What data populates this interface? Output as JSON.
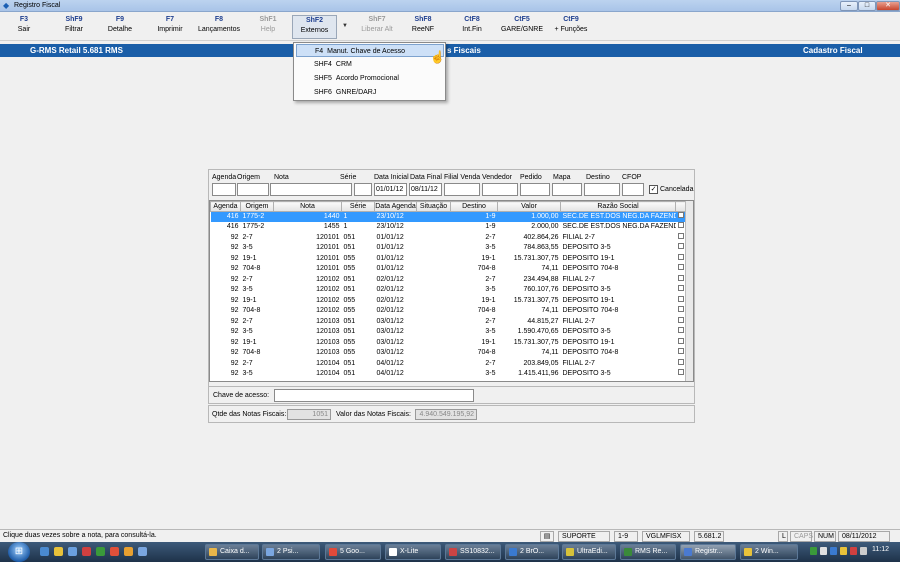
{
  "window": {
    "title": "Registro Fiscal"
  },
  "toolbar": [
    {
      "key": "F3",
      "label": "Sair",
      "enabled": true
    },
    {
      "key": "ShF9",
      "label": "Filtrar",
      "enabled": true
    },
    {
      "key": "F9",
      "label": "Detalhe",
      "enabled": true
    },
    {
      "key": "F7",
      "label": "Imprimir",
      "enabled": true
    },
    {
      "key": "F8",
      "label": "Lançamentos",
      "enabled": true
    },
    {
      "key": "ShF1",
      "label": "Help",
      "enabled": false
    },
    {
      "key": "ShF2",
      "label": "Externos",
      "enabled": true
    },
    {
      "key": "ShF7",
      "label": "Liberar Alt",
      "enabled": false
    },
    {
      "key": "ShF8",
      "label": "ReeNF",
      "enabled": true
    },
    {
      "key": "CtF8",
      "label": "Int.Fin",
      "enabled": true
    },
    {
      "key": "CtF5",
      "label": "GARE/GNRE",
      "enabled": true
    },
    {
      "key": "CtF9",
      "label": "+ Funções",
      "enabled": true
    }
  ],
  "banner": {
    "left": "G-RMS Retail 5.681 RMS",
    "center": "s Fiscais",
    "right": "Cadastro Fiscal"
  },
  "dropdown": [
    {
      "key": "F4",
      "label": "Manut. Chave de Acesso",
      "selected": true
    },
    {
      "key": "SHF4",
      "label": "CRM",
      "selected": false
    },
    {
      "key": "SHF5",
      "label": "Acordo Promocional",
      "selected": false
    },
    {
      "key": "SHF6",
      "label": "GNRE/DARJ",
      "selected": false
    }
  ],
  "filters": {
    "labels": [
      "Agenda",
      "Origem",
      "Nota",
      "Série",
      "Data Inicial",
      "Data Final",
      "Filial Venda",
      "Vendedor",
      "Pedido",
      "Mapa",
      "Destino",
      "CFOP"
    ],
    "data_inicial": "01/01/12",
    "data_final": "08/11/12",
    "cancelada_label": "Cancelada",
    "cancelada_checked": true
  },
  "grid": {
    "columns": [
      "Agenda",
      "Origem",
      "Nota",
      "Série",
      "Data Agenda",
      "Situação",
      "Destino",
      "Valor",
      "Razão Social"
    ],
    "rows": [
      [
        "416",
        "1775-2",
        "1440",
        "1",
        "23/10/12",
        "",
        "1-9",
        "1.000,00",
        "SEC.DE EST.DOS NEG.DA FAZENDA"
      ],
      [
        "416",
        "1775-2",
        "1455",
        "1",
        "23/10/12",
        "",
        "1-9",
        "2.000,00",
        "SEC.DE EST.DOS NEG.DA FAZENDA"
      ],
      [
        "92",
        "2-7",
        "120101",
        "051",
        "01/01/12",
        "",
        "2-7",
        "402.864,26",
        "FILIAL 2-7"
      ],
      [
        "92",
        "3-5",
        "120101",
        "051",
        "01/01/12",
        "",
        "3-5",
        "784.863,55",
        "DEPOSITO 3-5"
      ],
      [
        "92",
        "19-1",
        "120101",
        "055",
        "01/01/12",
        "",
        "19-1",
        "15.731.307,75",
        "DEPOSITO 19-1"
      ],
      [
        "92",
        "704-8",
        "120101",
        "055",
        "01/01/12",
        "",
        "704-8",
        "74,11",
        "DEPOSITO 704-8"
      ],
      [
        "92",
        "2-7",
        "120102",
        "051",
        "02/01/12",
        "",
        "2-7",
        "234.494,88",
        "FILIAL 2-7"
      ],
      [
        "92",
        "3-5",
        "120102",
        "051",
        "02/01/12",
        "",
        "3-5",
        "760.107,76",
        "DEPOSITO 3-5"
      ],
      [
        "92",
        "19-1",
        "120102",
        "055",
        "02/01/12",
        "",
        "19-1",
        "15.731.307,75",
        "DEPOSITO 19-1"
      ],
      [
        "92",
        "704-8",
        "120102",
        "055",
        "02/01/12",
        "",
        "704-8",
        "74,11",
        "DEPOSITO 704-8"
      ],
      [
        "92",
        "2-7",
        "120103",
        "051",
        "03/01/12",
        "",
        "2-7",
        "44.815,27",
        "FILIAL 2-7"
      ],
      [
        "92",
        "3-5",
        "120103",
        "051",
        "03/01/12",
        "",
        "3-5",
        "1.590.470,65",
        "DEPOSITO 3-5"
      ],
      [
        "92",
        "19-1",
        "120103",
        "055",
        "03/01/12",
        "",
        "19-1",
        "15.731.307,75",
        "DEPOSITO 19-1"
      ],
      [
        "92",
        "704-8",
        "120103",
        "055",
        "03/01/12",
        "",
        "704-8",
        "74,11",
        "DEPOSITO 704-8"
      ],
      [
        "92",
        "2-7",
        "120104",
        "051",
        "04/01/12",
        "",
        "2-7",
        "203.849,05",
        "FILIAL 2-7"
      ],
      [
        "92",
        "3-5",
        "120104",
        "051",
        "04/01/12",
        "",
        "3-5",
        "1.415.411,96",
        "DEPOSITO 3-5"
      ]
    ],
    "selected_row": 0
  },
  "chave": {
    "label": "Chave de acesso:",
    "value": ""
  },
  "totals": {
    "qtde_label": "Qtde das Notas Fiscais:",
    "qtde_value": "1051",
    "valor_label": "Valor  das Notas Fiscais:",
    "valor_value": "4.940.549.195,92"
  },
  "status": {
    "message": "Clique duas vezes sobre a nota, para consultá-la.",
    "user": "SUPORTE",
    "filial": "1-9",
    "host": "VGLMFISX",
    "version": "5.681.2",
    "l": "L",
    "caps": "CAPS",
    "num": "NUM",
    "date": "08/11/2012"
  },
  "taskbar": {
    "items": [
      {
        "label": "Caixa d...",
        "color": "#e8b64a"
      },
      {
        "label": "2 Psi...",
        "color": "#7aa6e0"
      },
      {
        "label": "5 Goo...",
        "color": "#e04a3a"
      },
      {
        "label": "X-Lite",
        "color": "#ffffff"
      },
      {
        "label": "SS10832...",
        "color": "#cc4444"
      },
      {
        "label": "2 BrO...",
        "color": "#3a7ad0"
      },
      {
        "label": "UltraEdi...",
        "color": "#d6c23a"
      },
      {
        "label": "RMS Re...",
        "color": "#3a8a3a"
      },
      {
        "label": "Registr...",
        "color": "#4a7ad0"
      },
      {
        "label": "2 Win...",
        "color": "#e8c23a"
      }
    ],
    "clock": "11:12"
  }
}
